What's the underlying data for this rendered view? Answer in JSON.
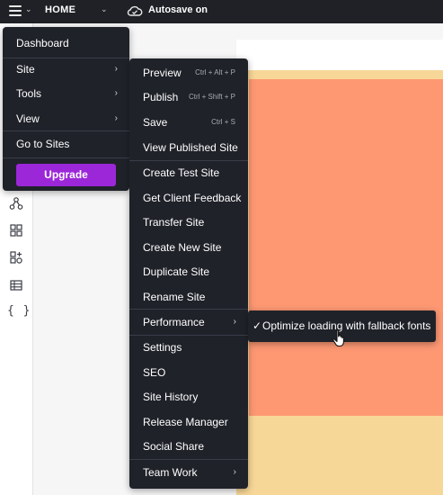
{
  "topbar": {
    "menu_icon": "hamburger-icon",
    "page_name": "HOME",
    "autosave_label": "Autosave on",
    "autosave_icon": "cloud-icon"
  },
  "leftbar": {
    "icons": [
      "connections-icon",
      "apps-grid-icon",
      "add-components-icon",
      "table-icon",
      "code-braces-icon"
    ],
    "braces": "{ }"
  },
  "main_menu": {
    "items": [
      {
        "label": "Dashboard"
      },
      {
        "label": "Site"
      },
      {
        "label": "Tools"
      },
      {
        "label": "View"
      },
      {
        "label": "Go to Sites"
      }
    ],
    "upgrade_label": "Upgrade",
    "upgrade_color": "#9c27d8"
  },
  "site_menu": {
    "items": [
      {
        "label": "Preview",
        "shortcut": "Ctrl + Alt + P"
      },
      {
        "label": "Publish",
        "shortcut": "Ctrl + Shift + P"
      },
      {
        "label": "Save",
        "shortcut": "Ctrl + S"
      },
      {
        "label": "View Published Site",
        "shortcut": ""
      },
      {
        "label": "Create Test Site",
        "shortcut": ""
      },
      {
        "label": "Get Client Feedback",
        "shortcut": ""
      },
      {
        "label": "Transfer Site",
        "shortcut": ""
      },
      {
        "label": "Create New Site",
        "shortcut": ""
      },
      {
        "label": "Duplicate Site",
        "shortcut": ""
      },
      {
        "label": "Rename Site",
        "shortcut": ""
      },
      {
        "label": "Performance",
        "shortcut": ""
      },
      {
        "label": "Settings",
        "shortcut": ""
      },
      {
        "label": "SEO",
        "shortcut": ""
      },
      {
        "label": "Site History",
        "shortcut": ""
      },
      {
        "label": "Release Manager",
        "shortcut": ""
      },
      {
        "label": "Social Share",
        "shortcut": ""
      },
      {
        "label": "Team Work",
        "shortcut": ""
      }
    ]
  },
  "performance_menu": {
    "check": "✓",
    "option_label": "Optimize loading with fallback fonts",
    "checked": true
  },
  "colors": {
    "menu_bg": "#20222a",
    "topbar_bg": "#1f2126",
    "canvas_salmon": "#fd9873",
    "canvas_yellow": "#f7d797"
  }
}
